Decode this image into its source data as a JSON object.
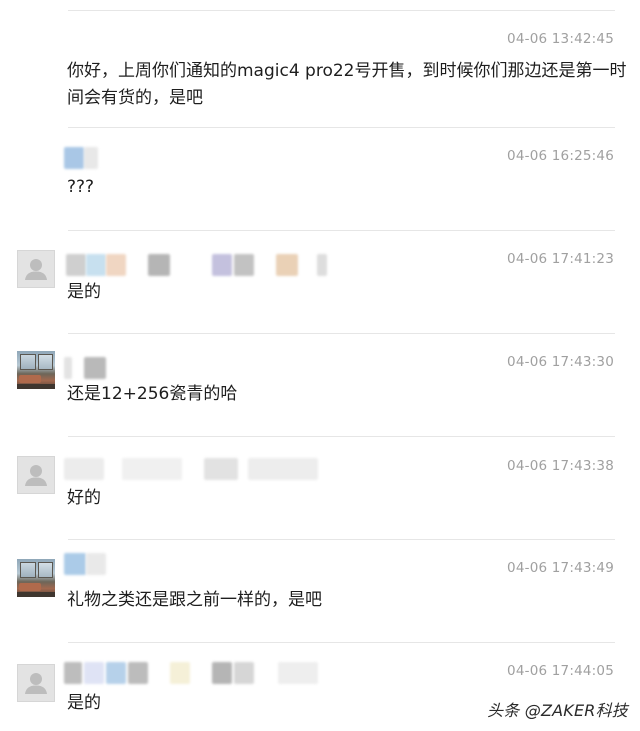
{
  "comments": [
    {
      "time": "04-06 13:42:45",
      "text": "你好，上周你们通知的magic4 pro22号开售，到时候你们那边还是第一时间会有货的，是吧",
      "avatar": "none"
    },
    {
      "time": "04-06 16:25:46",
      "text": "???",
      "avatar": "none"
    },
    {
      "time": "04-06 17:41:23",
      "text": "是的",
      "avatar": "default-user-icon"
    },
    {
      "time": "04-06 17:43:30",
      "text": "还是12+256瓷青的哈",
      "avatar": "photo-avatar"
    },
    {
      "time": "04-06 17:43:38",
      "text": "好的",
      "avatar": "default-user-icon"
    },
    {
      "time": "04-06 17:43:49",
      "text": "礼物之类还是跟之前一样的，是吧",
      "avatar": "photo-avatar"
    },
    {
      "time": "04-06 17:44:05",
      "text": "是的",
      "avatar": "default-user-icon"
    }
  ],
  "watermark": "头条 @ZAKER科技",
  "colors": {
    "divider": "#e6e6e6",
    "timestamp": "#a0a0a0",
    "text": "#1e1e1e",
    "avatar_bg": "#e3e3e3"
  }
}
